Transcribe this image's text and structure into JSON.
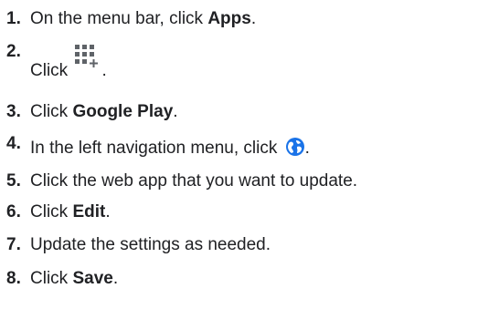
{
  "steps": [
    {
      "num": "1.",
      "pre": "On the menu bar, click ",
      "bold": "Apps",
      "post": "."
    },
    {
      "num": "2.",
      "pre": "Click ",
      "post": "."
    },
    {
      "num": "3.",
      "pre": "Click ",
      "bold": "Google Play",
      "post": "."
    },
    {
      "num": "4.",
      "pre": "In the left navigation menu, click ",
      "post": "."
    },
    {
      "num": "5.",
      "pre": "Click the web app that you want to update."
    },
    {
      "num": "6.",
      "pre": "Click ",
      "bold": "Edit",
      "post": "."
    },
    {
      "num": "7.",
      "pre": "Update the settings as needed."
    },
    {
      "num": "8.",
      "pre": "Click ",
      "bold": "Save",
      "post": "."
    }
  ],
  "icons": {
    "step2": "add-app-grid-icon",
    "step4": "web-apps-globe-icon"
  },
  "colors": {
    "text": "#202124",
    "globe_blue": "#1a73e8",
    "icon_gray": "#5f6368"
  }
}
